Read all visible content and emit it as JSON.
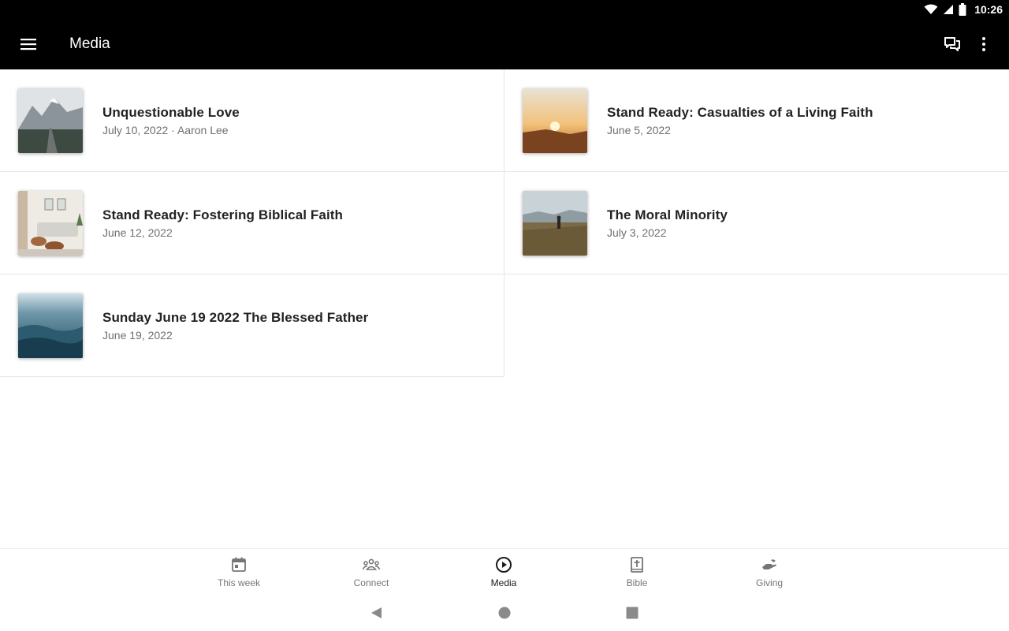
{
  "status_bar": {
    "time": "10:26"
  },
  "app_bar": {
    "title": "Media"
  },
  "media_items": [
    {
      "title": "Unquestionable Love",
      "subtitle": "July 10, 2022 · Aaron Lee"
    },
    {
      "title": "Stand Ready: Casualties of a Living Faith",
      "subtitle": "June 5, 2022"
    },
    {
      "title": "Stand Ready: Fostering Biblical Faith",
      "subtitle": "June 12, 2022"
    },
    {
      "title": "The Moral Minority",
      "subtitle": "July 3, 2022"
    },
    {
      "title": "Sunday June 19 2022 The Blessed Father",
      "subtitle": "June 19, 2022"
    }
  ],
  "bottom_nav": [
    {
      "label": "This week",
      "icon": "calendar-icon"
    },
    {
      "label": "Connect",
      "icon": "group-icon"
    },
    {
      "label": "Media",
      "icon": "play-circle-icon",
      "active": true
    },
    {
      "label": "Bible",
      "icon": "bible-icon"
    },
    {
      "label": "Giving",
      "icon": "giving-hand-icon"
    }
  ],
  "colors": {
    "app_bar": "#000000",
    "active_nav": "#1a1a1a",
    "inactive_nav": "#757575"
  }
}
